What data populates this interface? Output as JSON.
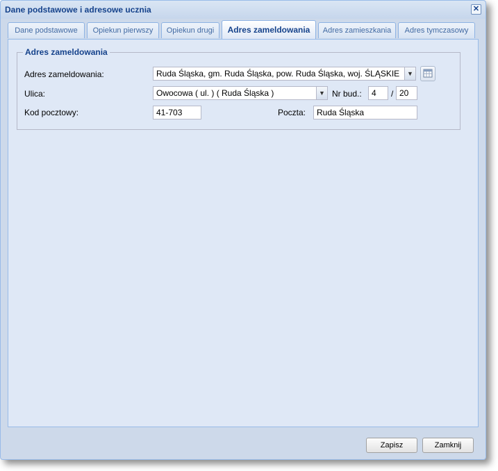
{
  "window": {
    "title": "Dane podstawowe i adresowe ucznia",
    "close_icon": "close-icon"
  },
  "tabs": [
    {
      "label": "Dane podstawowe",
      "active": false
    },
    {
      "label": "Opiekun pierwszy",
      "active": false
    },
    {
      "label": "Opiekun drugi",
      "active": false
    },
    {
      "label": "Adres zameldowania",
      "active": true
    },
    {
      "label": "Adres zamieszkania",
      "active": false
    },
    {
      "label": "Adres tymczasowy",
      "active": false
    }
  ],
  "form": {
    "legend": "Adres zameldowania",
    "address_label": "Adres zameldowania:",
    "address_value": "Ruda Śląska, gm. Ruda Śląska, pow. Ruda Śląska, woj. ŚLĄSKIE",
    "street_label": "Ulica:",
    "street_value": "Owocowa ( ul. ) ( Ruda Śląska )",
    "building_label": "Nr bud.:",
    "building_value": "4",
    "separator": "/",
    "apartment_value": "20",
    "postcode_label": "Kod pocztowy:",
    "postcode_value": "41-703",
    "post_label": "Poczta:",
    "post_value": "Ruda Śląska"
  },
  "footer": {
    "save_label": "Zapisz",
    "close_label": "Zamknij"
  }
}
